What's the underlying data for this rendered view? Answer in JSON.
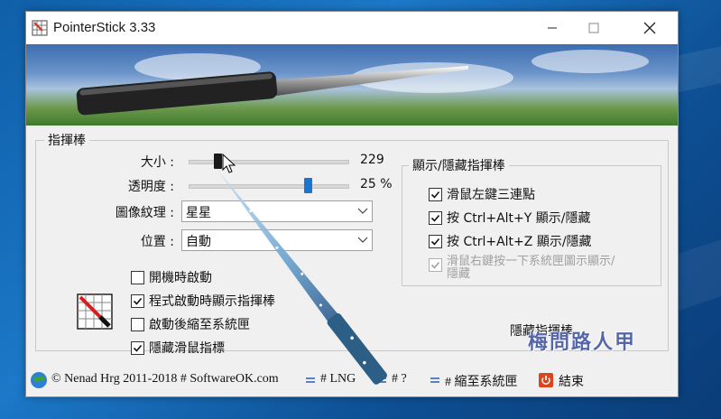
{
  "window": {
    "title": "PointerStick 3.33",
    "controls": {
      "minimize": "—",
      "maximize": "☐",
      "close": "✕"
    }
  },
  "stick_group": {
    "title": "指揮棒",
    "size": {
      "label": "大小 :",
      "value": "229",
      "level": 0.18
    },
    "transparency": {
      "label": "透明度 :",
      "value": "25 %",
      "level": 0.75
    },
    "texture": {
      "label": "圖像紋理 :",
      "selected": "星星"
    },
    "position": {
      "label": "位置 :",
      "selected": "自動"
    },
    "checkboxes": [
      {
        "label": "開機時啟動",
        "checked": false
      },
      {
        "label": "程式啟動時顯示指揮棒",
        "checked": true
      },
      {
        "label": "啟動後縮至系統匣",
        "checked": false
      },
      {
        "label": "隱藏滑鼠指標",
        "checked": true
      }
    ]
  },
  "toggle_group": {
    "title": "顯示/隱藏指揮棒",
    "checkboxes": [
      {
        "label": "滑鼠左鍵三連點",
        "checked": true,
        "disabled": false
      },
      {
        "label": "按 Ctrl+Alt+Y 顯示/隱藏",
        "checked": true,
        "disabled": false
      },
      {
        "label": "按 Ctrl+Alt+Z 顯示/隱藏",
        "checked": true,
        "disabled": false
      },
      {
        "label_line1": "滑鼠右鍵按一下系統匣圖示顯示/",
        "label_line2": "隱藏",
        "checked": true,
        "disabled": true
      }
    ],
    "hide_button": "隱藏指揮棒"
  },
  "statusbar": {
    "copyright": "© Nenad Hrg 2011-2018 # SoftwareOK.com",
    "lng": "# LNG",
    "help": "# ?",
    "tray": "# 縮至系統匣",
    "exit": "結束"
  },
  "watermark": "梅問路人甲",
  "colors": {
    "accent": "#1c74d1",
    "exit_icon": "#d9461e"
  }
}
